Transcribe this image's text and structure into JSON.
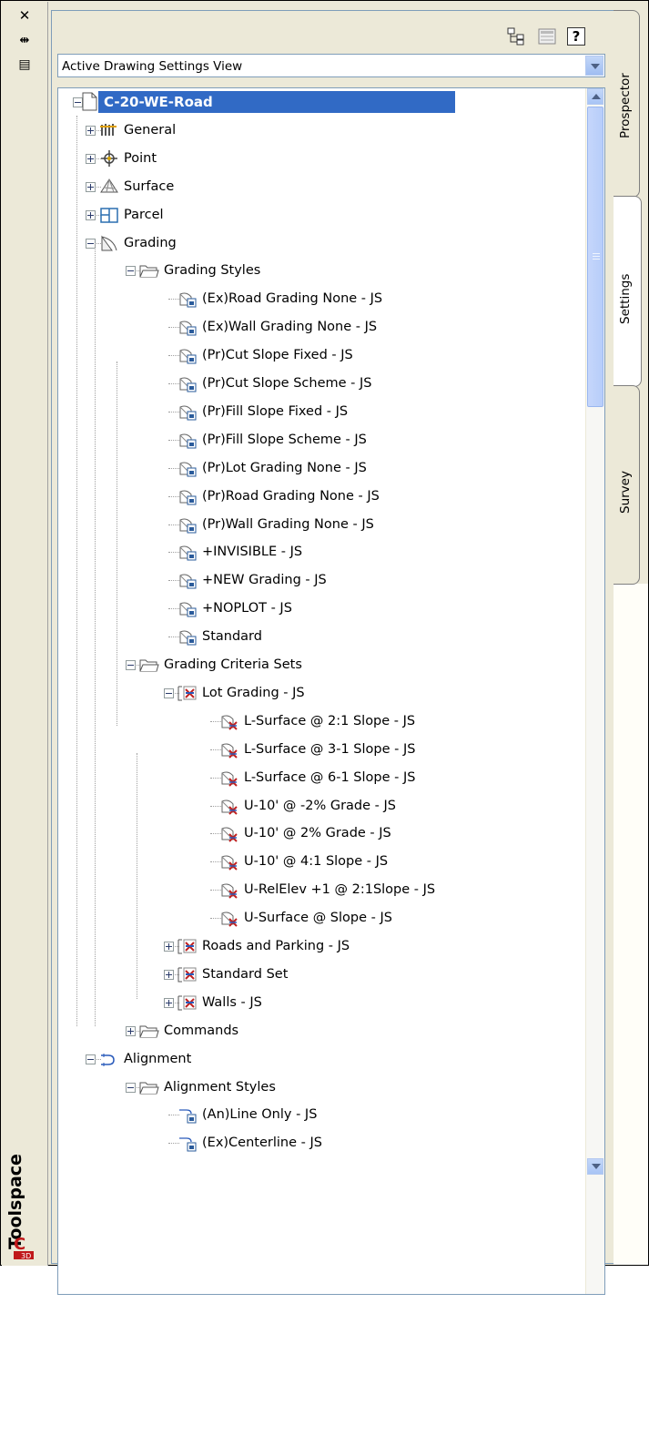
{
  "palette": {
    "title": "Toolspace",
    "dropdown_value": "Active Drawing Settings View",
    "close_label": "✕",
    "pin_label": "⇹",
    "menu_label": "▤",
    "help_label": "?"
  },
  "tabs": [
    {
      "label": "Prospector",
      "active": false
    },
    {
      "label": "Settings",
      "active": true
    },
    {
      "label": "Survey",
      "active": false
    }
  ],
  "tree": {
    "root_label": "C-20-WE-Road",
    "items": [
      {
        "label": "General",
        "icon": "general-icon"
      },
      {
        "label": "Point",
        "icon": "point-icon"
      },
      {
        "label": "Surface",
        "icon": "surface-icon"
      },
      {
        "label": "Parcel",
        "icon": "parcel-icon"
      },
      {
        "label": "Grading",
        "icon": "grading-icon"
      },
      {
        "label": "Grading Styles",
        "icon": "folder-icon"
      },
      {
        "label": "(Ex)Road Grading None - JS",
        "icon": "grading-style-icon"
      },
      {
        "label": "(Ex)Wall Grading None - JS",
        "icon": "grading-style-icon"
      },
      {
        "label": "(Pr)Cut Slope Fixed - JS",
        "icon": "grading-style-icon"
      },
      {
        "label": "(Pr)Cut Slope Scheme - JS",
        "icon": "grading-style-icon"
      },
      {
        "label": "(Pr)Fill Slope Fixed - JS",
        "icon": "grading-style-icon"
      },
      {
        "label": "(Pr)Fill Slope Scheme - JS",
        "icon": "grading-style-icon"
      },
      {
        "label": "(Pr)Lot Grading None - JS",
        "icon": "grading-style-icon"
      },
      {
        "label": "(Pr)Road Grading None - JS",
        "icon": "grading-style-icon"
      },
      {
        "label": "(Pr)Wall Grading None - JS",
        "icon": "grading-style-icon"
      },
      {
        "label": "+INVISIBLE - JS",
        "icon": "grading-style-icon"
      },
      {
        "label": "+NEW Grading - JS",
        "icon": "grading-style-icon"
      },
      {
        "label": "+NOPLOT - JS",
        "icon": "grading-style-icon"
      },
      {
        "label": "Standard",
        "icon": "grading-style-icon"
      },
      {
        "label": "Grading Criteria Sets",
        "icon": "folder-icon"
      },
      {
        "label": "Lot Grading - JS",
        "icon": "criteria-set-icon"
      },
      {
        "label": "L-Surface @ 2:1 Slope - JS",
        "icon": "criteria-icon"
      },
      {
        "label": "L-Surface @ 3-1 Slope - JS",
        "icon": "criteria-icon"
      },
      {
        "label": "L-Surface @ 6-1 Slope - JS",
        "icon": "criteria-icon"
      },
      {
        "label": "U-10' @ -2% Grade - JS",
        "icon": "criteria-icon"
      },
      {
        "label": "U-10' @ 2% Grade - JS",
        "icon": "criteria-icon"
      },
      {
        "label": "U-10' @ 4:1 Slope - JS",
        "icon": "criteria-icon"
      },
      {
        "label": "U-RelElev +1 @ 2:1Slope - JS",
        "icon": "criteria-icon"
      },
      {
        "label": "U-Surface @ Slope - JS",
        "icon": "criteria-icon"
      },
      {
        "label": "Roads and Parking - JS",
        "icon": "criteria-set-icon"
      },
      {
        "label": "Standard Set",
        "icon": "criteria-set-icon"
      },
      {
        "label": "Walls - JS",
        "icon": "criteria-set-icon"
      },
      {
        "label": "Commands",
        "icon": "folder-icon"
      },
      {
        "label": "Alignment",
        "icon": "alignment-icon"
      },
      {
        "label": "Alignment Styles",
        "icon": "folder-icon"
      },
      {
        "label": "(An)Line Only - JS",
        "icon": "alignment-style-icon"
      },
      {
        "label": "(Ex)Centerline - JS",
        "icon": "alignment-style-icon"
      }
    ]
  }
}
